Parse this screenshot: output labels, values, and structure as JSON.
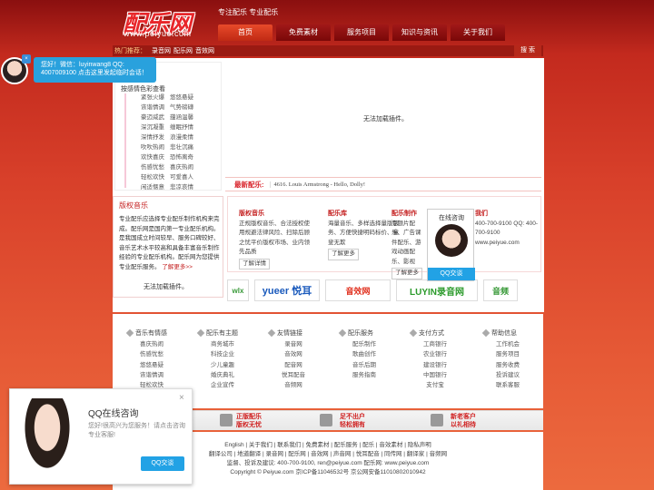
{
  "header": {
    "logo_text": "配乐网",
    "logo_url": "www.peiyue.com",
    "slogan": "专注配乐  专业配乐",
    "nav": [
      "首页",
      "免费素材",
      "服务项目",
      "知识与资讯",
      "关于我们"
    ],
    "hot_label": "热门推荐：",
    "hot_links": [
      "录音网",
      "配乐网",
      "音效网"
    ],
    "search_label": "搜 索"
  },
  "left_panel": {
    "heading": "按感情色彩查看",
    "items": [
      "紧张火爆",
      "悠悠悬疑",
      "诙谐情调",
      "气势磅礴",
      "豪迈威武",
      "蕴涵温馨",
      "深沉凝重",
      "缠眠抒情",
      "深情抒发",
      "浪漫柔情",
      "吹吹热闹",
      "悲壮沉痛",
      "欢快喜庆",
      "恐怖离奇",
      "伤感忧愁",
      "喜庆热闹",
      "轻松欢快",
      "可爱喜人",
      "闲适惬意",
      "悲凉哀情"
    ]
  },
  "main": {
    "no_load_1": "无法加载插件。",
    "ticker_label": "最新配乐:",
    "ticker_value": "4616. Louis Armstrong - Hello, Dolly!"
  },
  "copyright_box": {
    "title": "版权音乐",
    "text": "专业配乐应选择专业配乐制作机构来完成。配乐网是国内第一专业配乐机构。是我国成立时间较早、服务口碑较好、音乐艺术水平较高和具备丰富音乐制作经验的专业配乐机构。配乐网为您提供专业配乐服务。",
    "more": "了解更多>>",
    "no_load_2": "无法加载插件。"
  },
  "services": [
    {
      "title": "版权音乐",
      "text": "正规版权音乐、合法授权使用规避法律风险、扫除后顾之忧平价版权市场、业内领先品质",
      "btn": "了解详情"
    },
    {
      "title": "配乐库",
      "text": "海量音乐、多样选择量版服务、方便快捷明码标价、童叟无欺",
      "btn": "了解更多"
    },
    {
      "title": "配乐制作",
      "text": "专题片配乐、广告课件配乐、游戏动画配乐、影视",
      "btn": "了解更多"
    },
    {
      "title": "我们",
      "text": "400-700-9100 QQ: 400-700-9100 www.peiyue.com",
      "btn": ""
    }
  ],
  "logos": [
    "wlx",
    "yueer 悦耳",
    "音效网",
    "LUYIN录音网",
    "音频"
  ],
  "footer_columns": [
    {
      "heading": "音乐有情感",
      "links": [
        "喜庆热闹",
        "伤感忧愁",
        "悠悠悬疑",
        "诙谐情调",
        "轻松欢快"
      ]
    },
    {
      "heading": "配乐有主题",
      "links": [
        "商务城市",
        "科技企业",
        "少儿童趣",
        "婚庆典礼",
        "企业宣传"
      ]
    },
    {
      "heading": "友情链接",
      "links": [
        "录音网",
        "音效网",
        "配音网",
        "悦耳配音",
        "音频网"
      ]
    },
    {
      "heading": "配乐服务",
      "links": [
        "配乐制作",
        "歌曲创作",
        "音乐后期",
        "服务指南"
      ]
    },
    {
      "heading": "支付方式",
      "links": [
        "工商银行",
        "农业银行",
        "建设银行",
        "中国银行",
        "支付宝"
      ]
    },
    {
      "heading": "帮助信息",
      "links": [
        "工作机会",
        "服务项目",
        "服务收费",
        "投诉建议",
        "联系客服"
      ]
    }
  ],
  "promo": [
    {
      "l1": "正版配乐",
      "l2": "版权无忧"
    },
    {
      "l1": "足不出户",
      "l2": "轻松拥有"
    },
    {
      "l1": "新老客户",
      "l2": "以礼相待"
    }
  ],
  "bottom": {
    "line1": "English | 关于我们 | 联系我们 | 免费素材 | 配乐服务 | 配乐 | 音效素材 | 隐私声明",
    "line2": "翻译公司 | 地道翻译 | 录音网 | 配乐网 | 音效网 | 声音网 | 悦耳配音 | 同传网 | 翻译家 | 音频网",
    "line3": "监督、投诉及建议: 400-700-9100, ren@peiyue.com 配乐网: www.peiyue.com",
    "line4": "Copyright © Peiyue.com 京ICP备11046532号 京公网安备11010802010942"
  },
  "chat": {
    "tip_line1": "您好！微信：luyinwang8 QQ:",
    "tip_line2": "4007009100 点击这里发起临时会话！",
    "float_title": "在线咨询",
    "float_btn": "QQ交谈",
    "popup_title": "QQ在线咨询",
    "popup_text": "您好!很高兴为您服务！请点击咨询专业客服!",
    "popup_btn": "QQ交谈",
    "close": "×"
  },
  "colors": {
    "brand_red": "#c42020",
    "qq_blue": "#22a2e5"
  }
}
